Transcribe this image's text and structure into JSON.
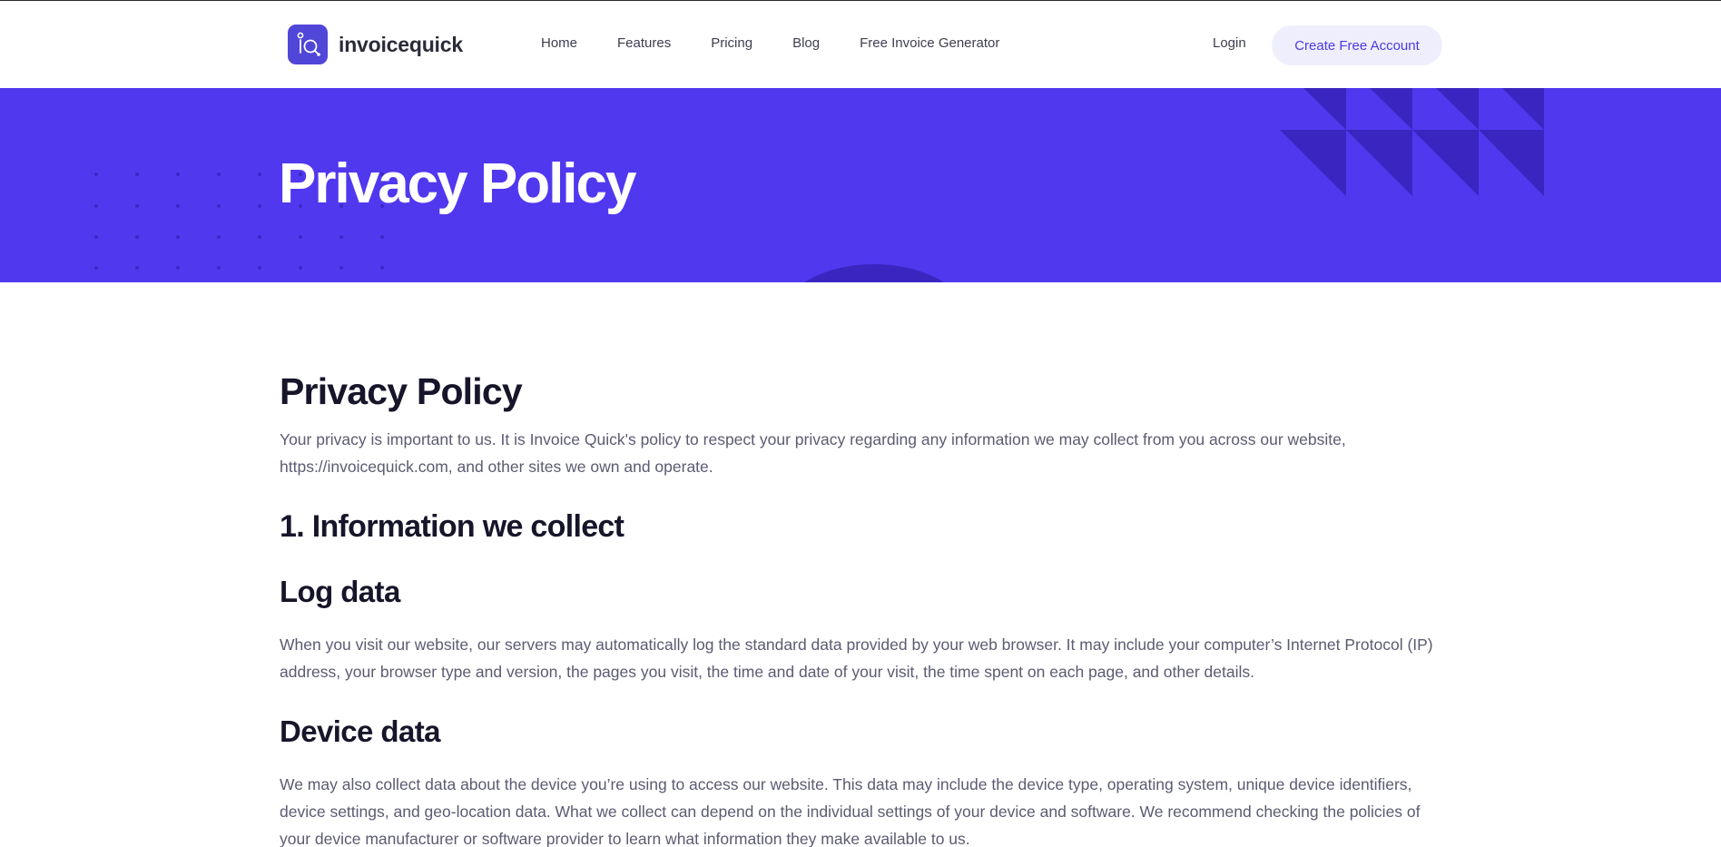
{
  "brand": {
    "name": "invoicequick",
    "logo_color": "#5046d8"
  },
  "nav": {
    "items": [
      {
        "label": "Home"
      },
      {
        "label": "Features"
      },
      {
        "label": "Pricing"
      },
      {
        "label": "Blog"
      },
      {
        "label": "Free Invoice Generator"
      }
    ],
    "login_label": "Login",
    "cta_label": "Create Free Account"
  },
  "hero": {
    "title": "Privacy Policy",
    "background_color": "#5038ef"
  },
  "document": {
    "title": "Privacy Policy",
    "intro": "Your privacy is important to us. It is Invoice Quick's policy to respect your privacy regarding any information we may collect from you across our website, https://invoicequick.com, and other sites we own and operate.",
    "section_1_heading": "1. Information we collect",
    "log_data_heading": "Log data",
    "log_data_text": "When you visit our website, our servers may automatically log the standard data provided by your web browser. It may include your computer’s Internet Protocol (IP) address, your browser type and version, the pages you visit, the time and date of your visit, the time spent on each page, and other details.",
    "device_data_heading": "Device data",
    "device_data_text": "We may also collect data about the device you’re using to access our website. This data may include the device type, operating system, unique device identifiers, device settings, and geo-location data. What we collect can depend on the individual settings of your device and software. We recommend checking the policies of your device manufacturer or software provider to learn what information they make available to us."
  },
  "colors": {
    "accent": "#5038ef",
    "heading": "#16152a",
    "body_text": "#5b5b72",
    "cta_background": "#efeefc",
    "cta_text": "#4a3be0"
  }
}
